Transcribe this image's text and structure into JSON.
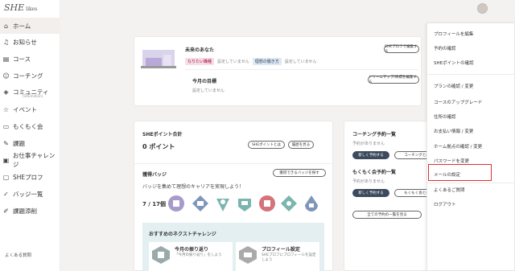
{
  "sidebar": {
    "logo": "SHE",
    "logo_sub": "likes",
    "items": [
      {
        "label": "ホーム",
        "icon": "home-icon"
      },
      {
        "label": "お知らせ",
        "icon": "bell-icon"
      },
      {
        "label": "コース",
        "icon": "course-icon"
      },
      {
        "label": "コーチング",
        "icon": "coaching-icon"
      },
      {
        "label": "コミュニティ",
        "sub": "(SHEmation)",
        "icon": "community-icon"
      },
      {
        "label": "イベント",
        "icon": "star-icon"
      },
      {
        "label": "もくもく会",
        "icon": "laptop-icon"
      },
      {
        "label": "課題",
        "icon": "pencil-icon"
      },
      {
        "label": "お仕事チャレンジ",
        "icon": "briefcase-icon"
      },
      {
        "label": "SHEプロフ",
        "icon": "profile-icon"
      },
      {
        "label": "バッジ一覧",
        "icon": "badge-check-icon"
      },
      {
        "label": "課題添削",
        "icon": "edit-icon"
      }
    ],
    "faq": "よくある質問"
  },
  "profile_card": {
    "title": "未来のあなた",
    "tag1": "なりたい職種",
    "tag1_value": "設定していません",
    "tag2": "理想の働き方",
    "tag2_value": "設定していません",
    "edit_button": "SHEプロフで編集する",
    "goal_title": "今月の目標",
    "goal_value": "設定していません",
    "roadmap_button": "ドリームマップ/目標を編集する"
  },
  "points_card": {
    "title": "SHEポイント合計",
    "value": "0 ポイント",
    "about_button": "SHEポイントとは",
    "history_button": "履歴を見る",
    "badges_title": "獲得バッジ",
    "badges_button": "獲得できるバッジを探す",
    "badges_desc": "バッジを集めて理想のキャリアを実現しよう！",
    "badges_count": "7 / 17個",
    "next_title": "おすすめのネクストチャレンジ",
    "challenge1_title": "今月の振り返り",
    "challenge1_desc": "「今月の振り返り」をしよう",
    "challenge2_title": "プロフィール設定",
    "challenge2_desc": "SHEプロフにプロフィールを設定しよう"
  },
  "schedule_card": {
    "coaching_title": "コーチング予約一覧",
    "coaching_empty": "予約がありません",
    "coaching_new": "新しく予約する",
    "coaching_other": "コーチングとは",
    "mokumoku_title": "もくもく会予約一覧",
    "mokumoku_empty": "予約がありません",
    "mokumoku_new": "新しく予約する",
    "mokumoku_other": "もくもく会とは",
    "all_button": "全ての予約の一覧を見る"
  },
  "dropdown": {
    "items": [
      "プロフィールを編集",
      "予約の確認",
      "SHEポイントの確認",
      "プランの確認 / 変更",
      "コースのアップグレード",
      "住所の確認",
      "お支払い情報 / 変更",
      "ホーム拠点の確認 / 変更",
      "パスワードを変更",
      "メールの設定",
      "よくあるご質問",
      "ログアウト"
    ]
  },
  "colors": {
    "accent": "#3c4a5c",
    "highlight": "#e03030",
    "tag_pink": "#f6dfe2"
  }
}
